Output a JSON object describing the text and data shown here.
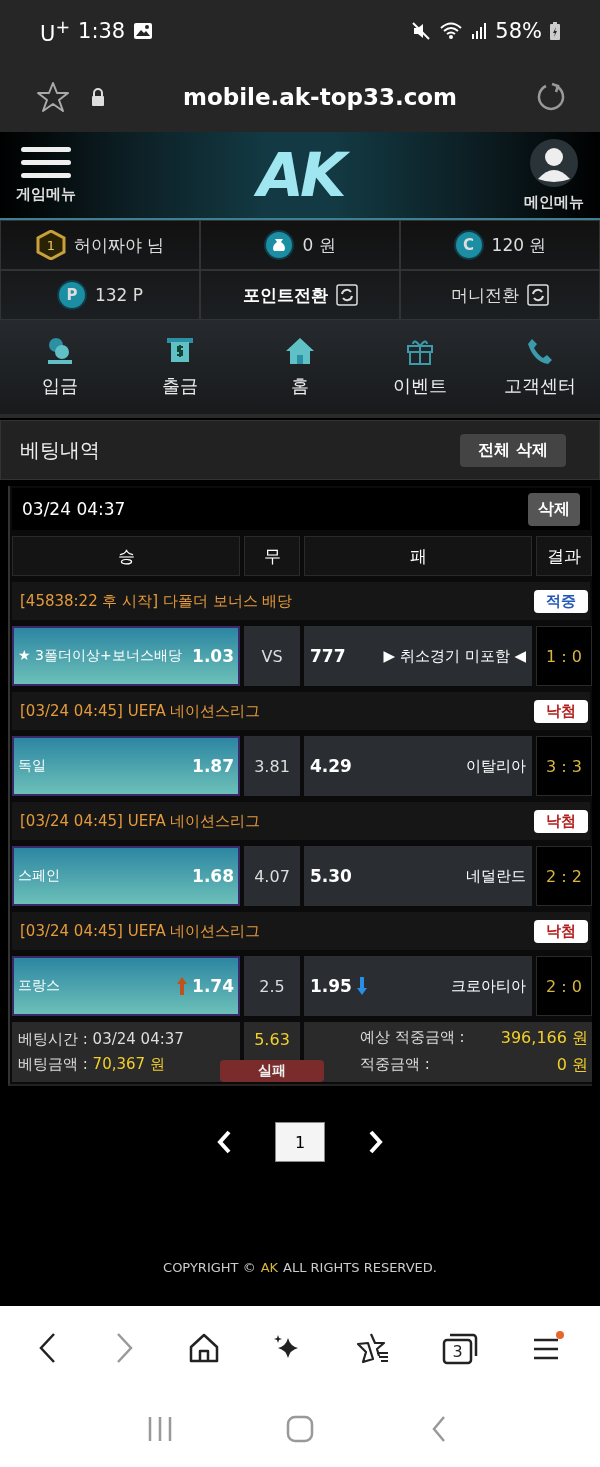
{
  "status_bar": {
    "carrier": "U$^{+}$",
    "time": "1:38",
    "battery": "58%"
  },
  "address_bar": {
    "url": "mobile.ak-top33.com"
  },
  "header": {
    "left_label": "게임메뉴",
    "logo": "AK",
    "right_label": "메인메뉴"
  },
  "account": [
    {
      "kind": "level",
      "badge": "1",
      "text": "허이짜야 님",
      "bold": false
    },
    {
      "kind": "coin",
      "text": "0 원",
      "bold": false
    },
    {
      "kind": "cash",
      "badge": "C",
      "text": "120 원",
      "bold": false
    },
    {
      "kind": "point",
      "badge": "P",
      "text": "132 P",
      "bold": false
    },
    {
      "kind": "convert",
      "text": "포인트전환",
      "bold": true
    },
    {
      "kind": "convert",
      "text": "머니전환",
      "bold": false
    }
  ],
  "nav": [
    {
      "kind": "deposit",
      "label": "입금"
    },
    {
      "kind": "withdraw",
      "label": "출금"
    },
    {
      "kind": "home",
      "label": "홈"
    },
    {
      "kind": "event",
      "label": "이벤트"
    },
    {
      "kind": "support",
      "label": "고객센터"
    }
  ],
  "section": {
    "title": "베팅내역",
    "delete_all": "전체 삭제"
  },
  "bet": {
    "date": "03/24 04:37",
    "delete": "삭제",
    "columns": [
      "승",
      "무",
      "패",
      "결과"
    ],
    "games": [
      {
        "league": "[45838:22 후 시작] 다폴더 보너스 배당",
        "hit": true,
        "result_label": "적중",
        "home": "★ 3폴더이상+보너스배당",
        "home_odds": "1.03",
        "home_selected": true,
        "draw": "VS",
        "away_odds": "777",
        "away": "▶ 취소경기 미포함 ◀",
        "score": "1 : 0"
      },
      {
        "league": "[03/24 04:45] UEFA 네이션스리그",
        "hit": false,
        "result_label": "낙첨",
        "home": "독일",
        "home_odds": "1.87",
        "home_selected": true,
        "draw": "3.81",
        "away_odds": "4.29",
        "away": "이탈리아",
        "score": "3 : 3"
      },
      {
        "league": "[03/24 04:45] UEFA 네이션스리그",
        "hit": false,
        "result_label": "낙첨",
        "home": "스페인",
        "home_odds": "1.68",
        "home_selected": true,
        "draw": "4.07",
        "away_odds": "5.30",
        "away": "네덜란드",
        "score": "2 : 2"
      },
      {
        "league": "[03/24 04:45] UEFA 네이션스리그",
        "hit": false,
        "result_label": "낙첨",
        "home": "프랑스",
        "home_odds": "1.74",
        "home_selected": true,
        "home_odds_rising": true,
        "draw": "2.5",
        "away_odds": "1.95",
        "away_odds_falling": true,
        "away": "크로아티아",
        "score": "2 : 0"
      }
    ],
    "summary": {
      "bet_time": "베팅시간 : 03/24 04:37",
      "amount_label": "베팅금액 :",
      "amount": "70,367 원",
      "total_odds": "5.63",
      "outcome": "실패",
      "expected_label": "예상 적중금액 :",
      "expected": "396,166 원",
      "won_label": "적중금액 :",
      "won": "0 원"
    }
  },
  "pagination": {
    "pages": [
      {
        "label": "1",
        "selected": true
      }
    ]
  },
  "footer": {
    "prefix": "COPYRIGHT ©",
    "brand": "AK",
    "suffix": "ALL RIGHTS RESERVED."
  },
  "browser_toolbar": {
    "tab_count": "3"
  }
}
